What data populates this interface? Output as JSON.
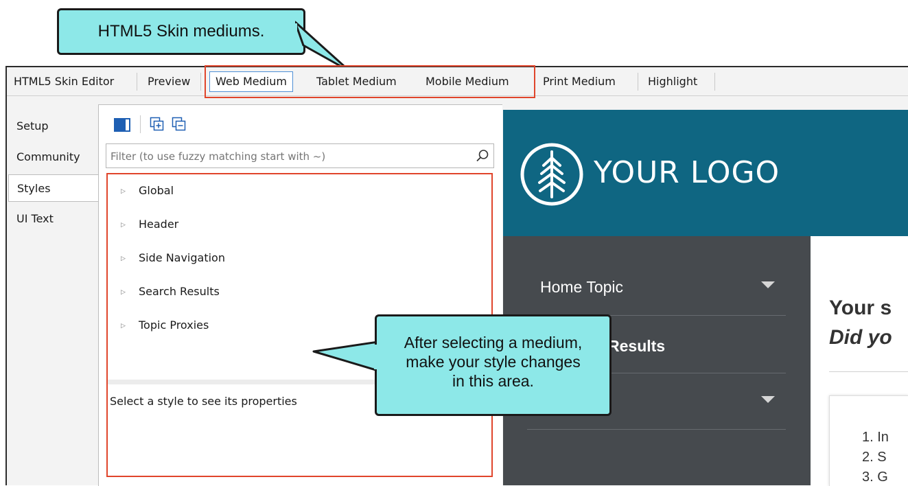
{
  "callouts": {
    "top": "HTML5 Skin mediums.",
    "bottom_lines": [
      "After selecting a medium,",
      "make your style changes",
      "in this area."
    ]
  },
  "tabs": {
    "skin_editor": "HTML5 Skin Editor",
    "preview": "Preview",
    "web": "Web Medium",
    "tablet": "Tablet Medium",
    "mobile": "Mobile Medium",
    "print": "Print Medium",
    "highlight": "Highlight"
  },
  "side_tabs": [
    "Setup",
    "Community",
    "Styles",
    "UI Text"
  ],
  "filter": {
    "placeholder": "Filter (to use fuzzy matching start with ~)"
  },
  "styles_tree": [
    "Global",
    "Header",
    "Side Navigation",
    "Search Results",
    "Topic Proxies"
  ],
  "properties_hint": "Select a style to see its properties",
  "preview": {
    "logo_text": "YOUR LOGO",
    "nav": [
      "Home Topic",
      "Results"
    ],
    "main_heading": "Your s",
    "main_sub": "Did yo",
    "list": [
      "1. In",
      "2. S",
      "3. G"
    ]
  },
  "colors": {
    "header_bg": "#0f6682",
    "nav_bg": "#464a4e",
    "callout_bg": "#8de8e8",
    "highlight_border": "#e0452b",
    "selected_tab_border": "#4d8fd6"
  }
}
